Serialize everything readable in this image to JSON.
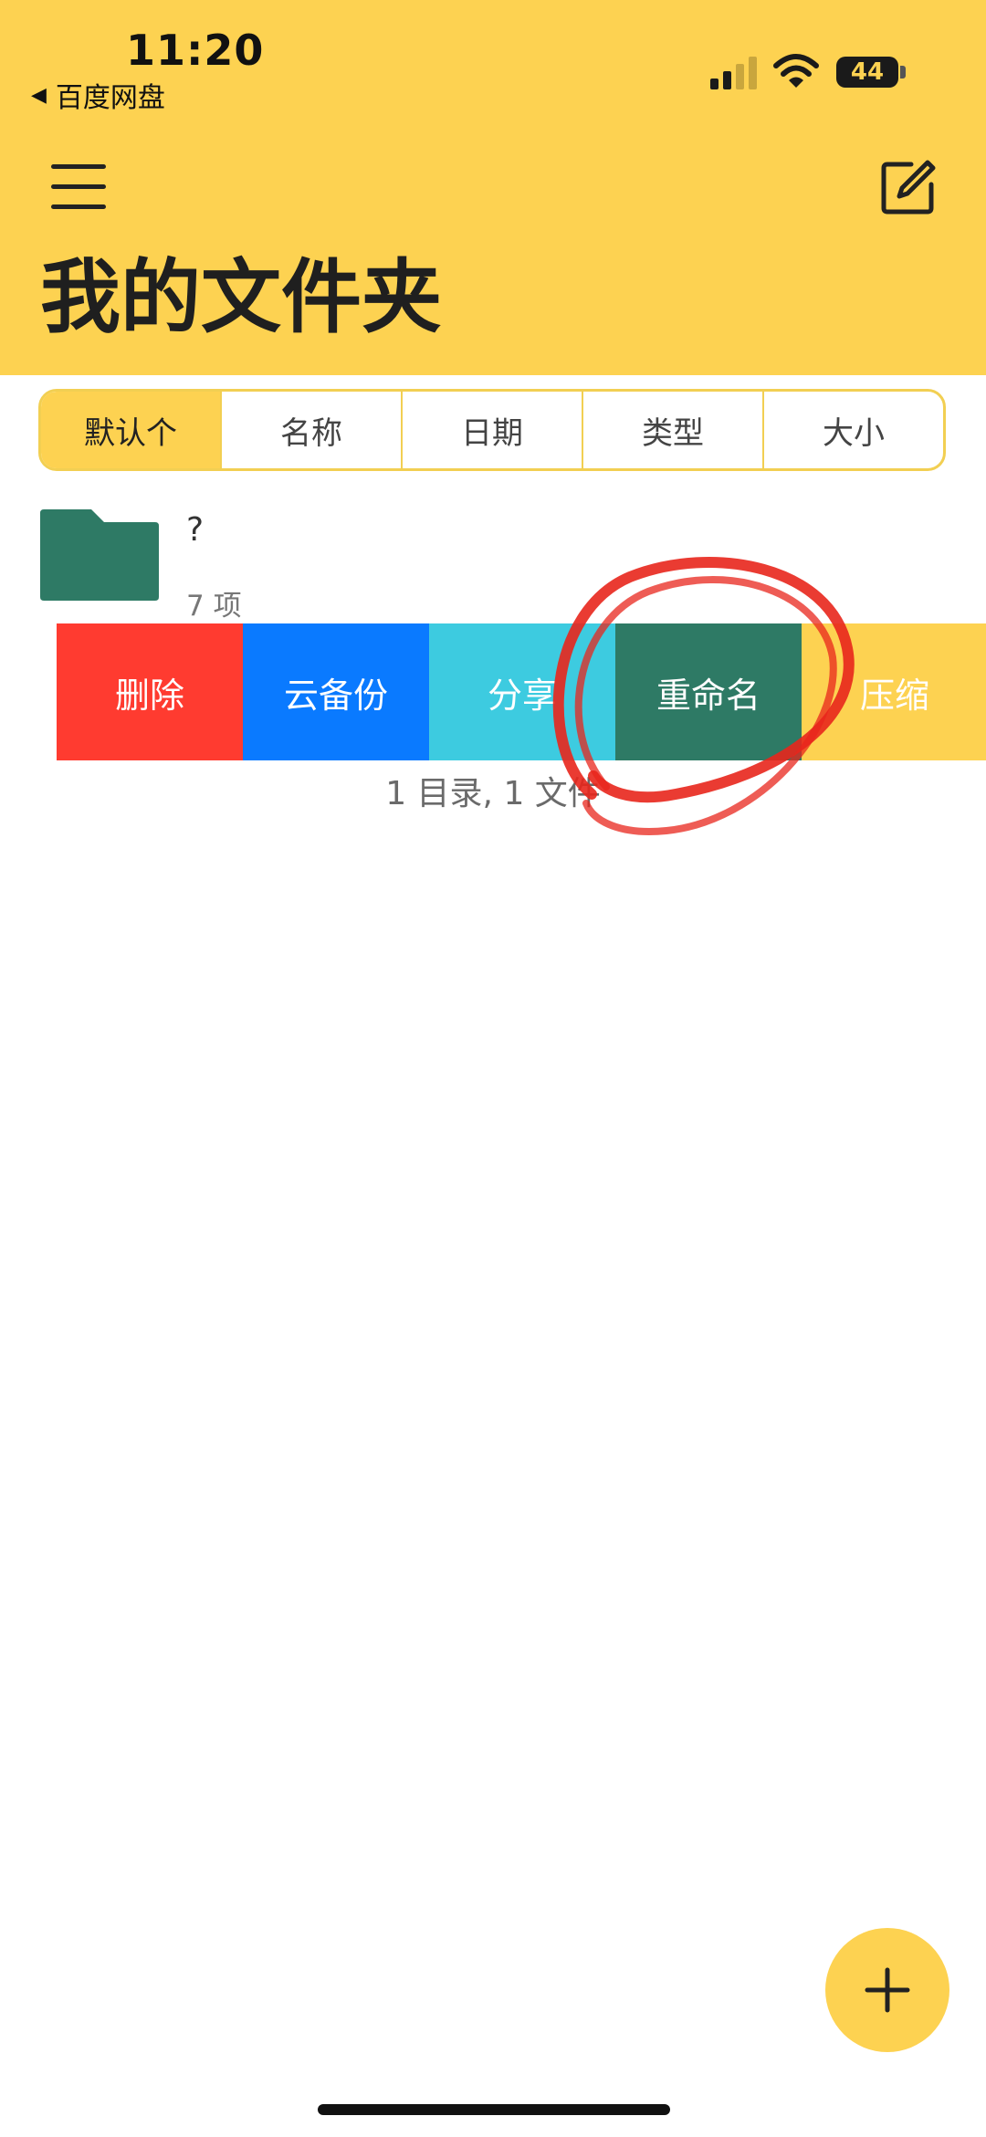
{
  "status_bar": {
    "time": "11:20",
    "back_app": "百度网盘",
    "battery": "44"
  },
  "header": {
    "title": "我的文件夹"
  },
  "sort_options": [
    {
      "label": "默认",
      "suffix": "个",
      "active": true
    },
    {
      "label": "名称"
    },
    {
      "label": "日期"
    },
    {
      "label": "类型"
    },
    {
      "label": "大小"
    }
  ],
  "folder": {
    "name": "?",
    "count": "7 项"
  },
  "actions": {
    "delete": "删除",
    "cloud_backup": "云备份",
    "share": "分享",
    "rename": "重命名",
    "compress": "压缩"
  },
  "summary": "1 目录, 1 文件",
  "colors": {
    "accent": "#FDD251",
    "delete": "#FF3B30",
    "cloud": "#0A7AFF",
    "share": "#3DCBE0",
    "rename": "#2E7A65",
    "annotation": "#E8261C"
  },
  "icons": [
    "menu-icon",
    "edit-icon",
    "folder-icon",
    "plus-icon",
    "signal-icon",
    "wifi-icon",
    "battery-icon"
  ]
}
